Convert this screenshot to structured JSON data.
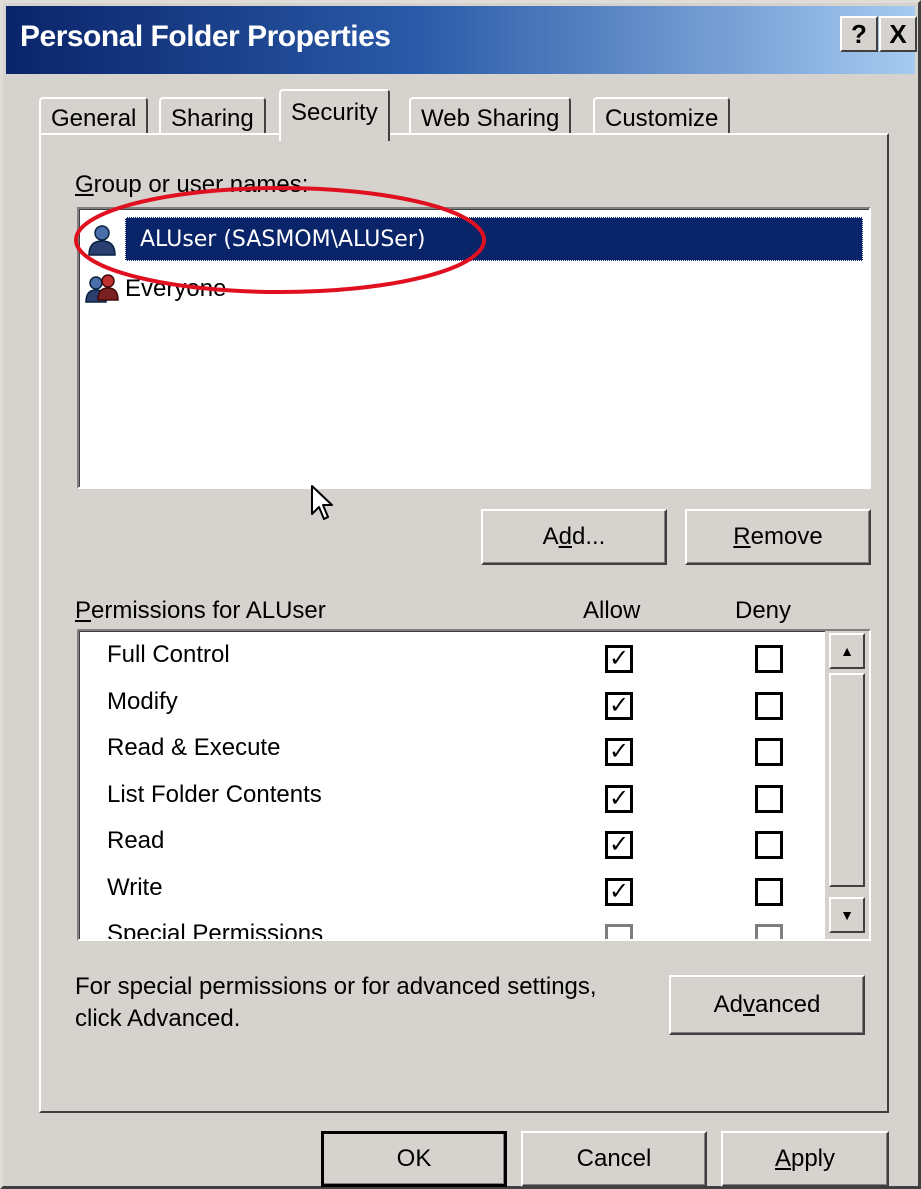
{
  "window": {
    "title": "Personal Folder Properties",
    "help_glyph": "?",
    "close_glyph": "X"
  },
  "tabs": [
    {
      "label": "General"
    },
    {
      "label": "Sharing"
    },
    {
      "label": "Security",
      "active": true
    },
    {
      "label": "Web Sharing"
    },
    {
      "label": "Customize"
    }
  ],
  "groups": {
    "label_mnemonic": "G",
    "label_rest": "roup or user names:",
    "items": [
      {
        "name": "ALUser (SASMOM\\ALUSer)",
        "selected": true,
        "icon": "user-icon"
      },
      {
        "name": "Everyone",
        "selected": false,
        "icon": "group-icon"
      }
    ],
    "add_button": {
      "pre": "A",
      "mnemonic": "d",
      "post": "d..."
    },
    "remove_button": {
      "mnemonic": "R",
      "post": "emove"
    }
  },
  "permissions": {
    "label_mnemonic": "P",
    "label_rest": "ermissions for ALUser",
    "allow_header": "Allow",
    "deny_header": "Deny",
    "check_glyph": "✓",
    "rows": [
      {
        "name": "Full Control",
        "allow": true,
        "deny": false
      },
      {
        "name": "Modify",
        "allow": true,
        "deny": false
      },
      {
        "name": "Read & Execute",
        "allow": true,
        "deny": false
      },
      {
        "name": "List Folder Contents",
        "allow": true,
        "deny": false
      },
      {
        "name": "Read",
        "allow": true,
        "deny": false
      },
      {
        "name": "Write",
        "allow": true,
        "deny": false
      },
      {
        "name": "Special Permissions",
        "allow": false,
        "deny": false
      }
    ]
  },
  "advanced": {
    "text_line1": "For special permissions or for advanced settings,",
    "text_line2": "click Advanced.",
    "button": {
      "pre": "Ad",
      "mnemonic": "v",
      "post": "anced"
    }
  },
  "footer": {
    "ok": "OK",
    "cancel": "Cancel",
    "apply": {
      "mnemonic": "A",
      "post": "pply"
    }
  },
  "colors": {
    "annotation": "#e01020",
    "selection": "#0a246a",
    "face": "#d6d3ce"
  }
}
